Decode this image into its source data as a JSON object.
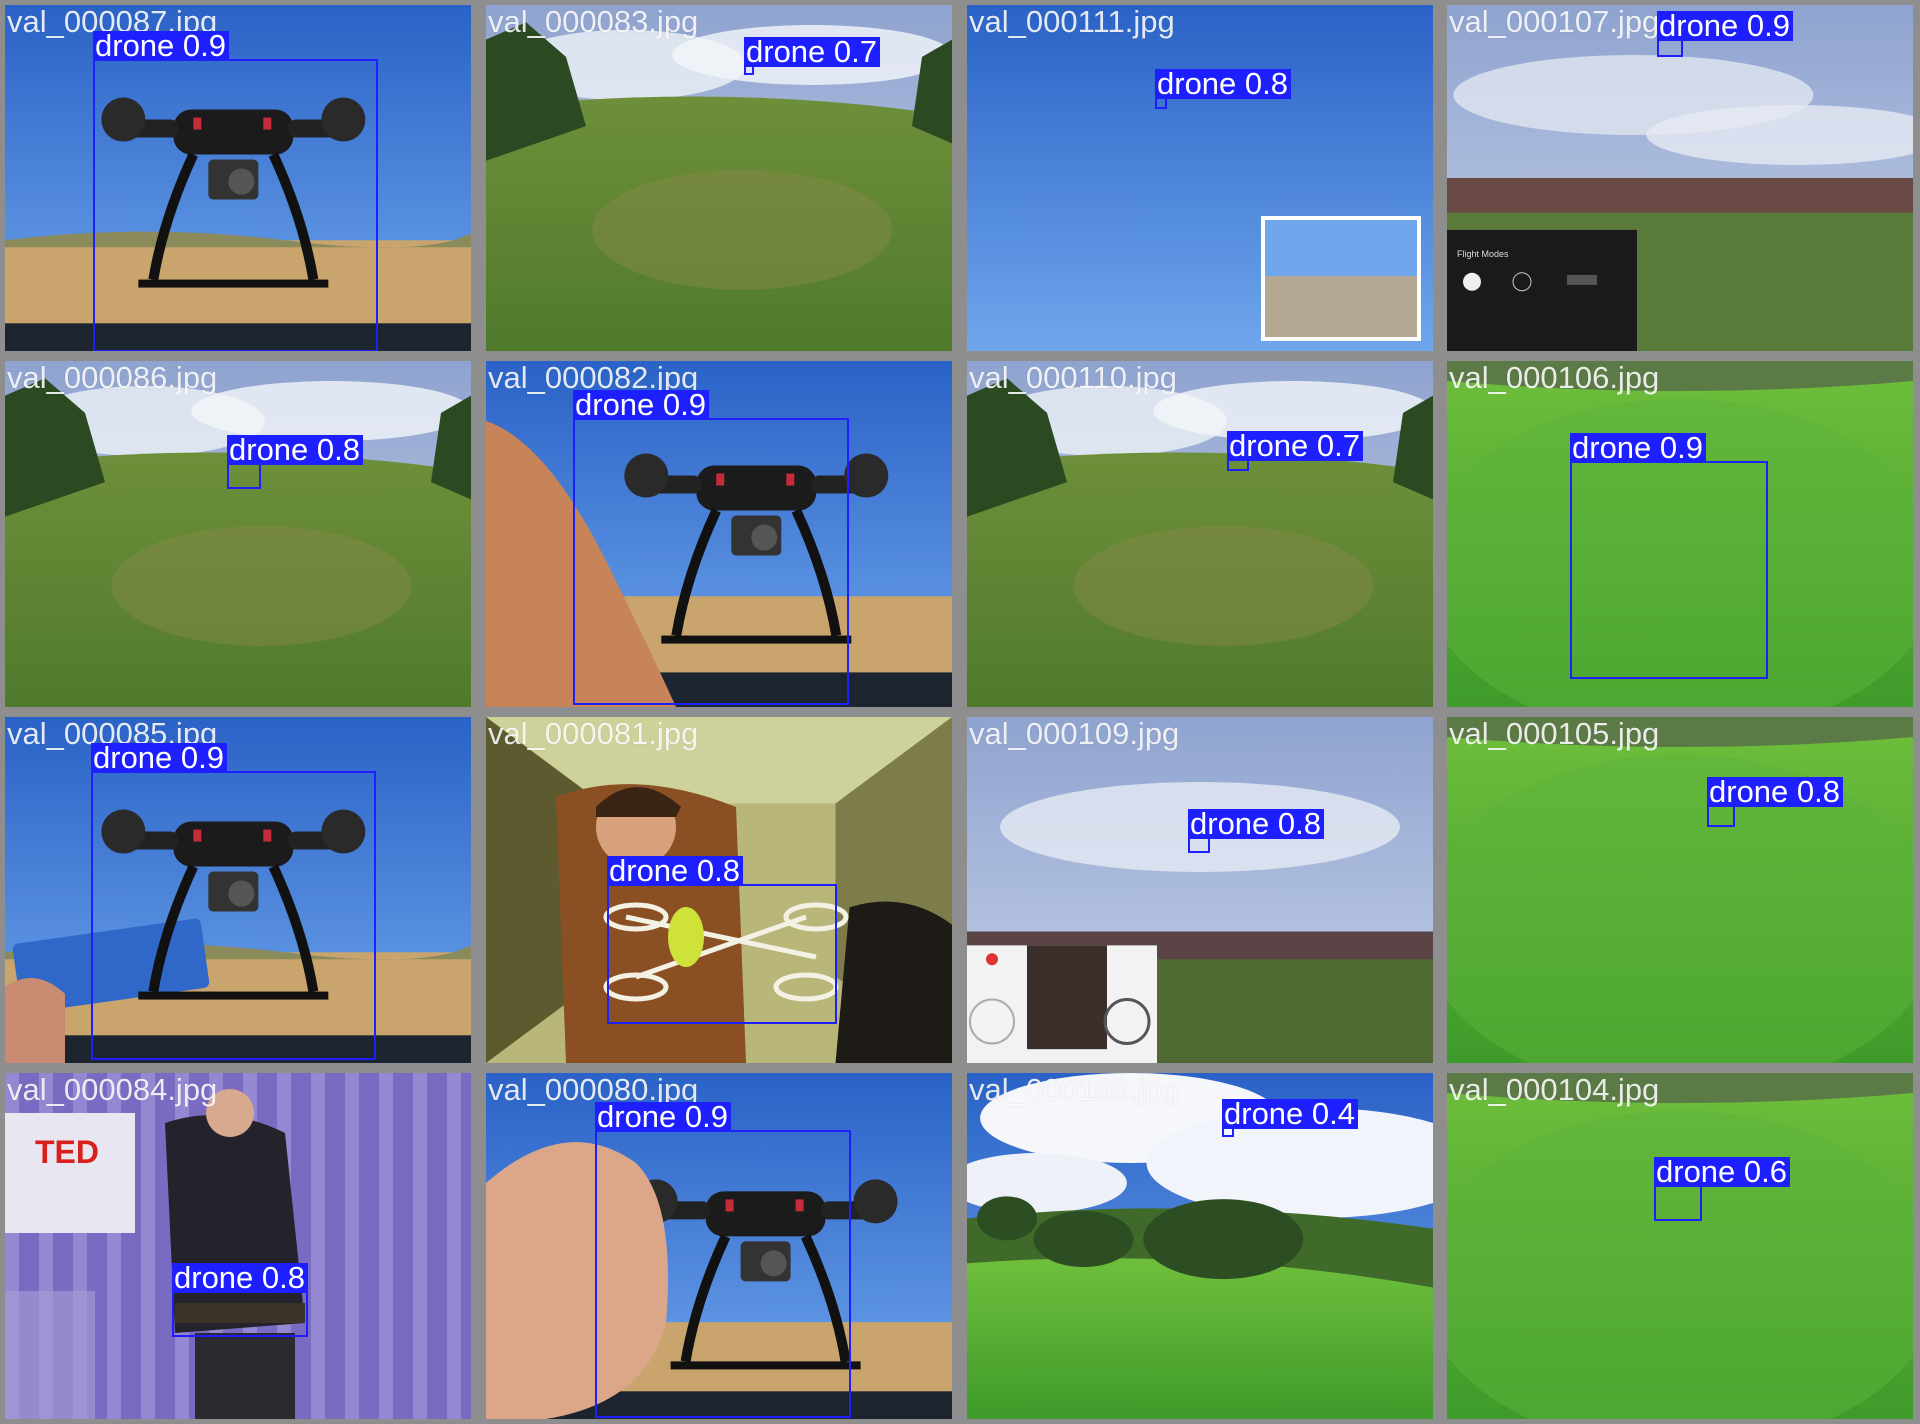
{
  "colors": {
    "background": "#8e8e8e",
    "box": "#1d1fff",
    "label_text": "#ffffff",
    "filename_text": "#ffffff"
  },
  "tiles": [
    {
      "filename": "val_000087.jpg",
      "scene": "drone-desert",
      "detections": [
        {
          "label": "drone 0.9"
        }
      ]
    },
    {
      "filename": "val_000083.jpg",
      "scene": "field-sky",
      "detections": [
        {
          "label": "drone 0.7"
        }
      ]
    },
    {
      "filename": "val_000111.jpg",
      "scene": "sky-inset",
      "detections": [
        {
          "label": "drone 0.8"
        }
      ]
    },
    {
      "filename": "val_000107.jpg",
      "scene": "cloud-app",
      "detections": [
        {
          "label": "drone 0.9"
        }
      ]
    },
    {
      "filename": "val_000086.jpg",
      "scene": "field-sky",
      "detections": [
        {
          "label": "drone 0.8"
        }
      ]
    },
    {
      "filename": "val_000082.jpg",
      "scene": "drone-arm",
      "detections": [
        {
          "label": "drone 0.9"
        }
      ]
    },
    {
      "filename": "val_000110.jpg",
      "scene": "field-sky",
      "detections": [
        {
          "label": "drone 0.7"
        }
      ]
    },
    {
      "filename": "val_000106.jpg",
      "scene": "green-grass",
      "detections": [
        {
          "label": "drone 0.9"
        }
      ]
    },
    {
      "filename": "val_000085.jpg",
      "scene": "drone-battery",
      "detections": [
        {
          "label": "drone 0.9"
        }
      ]
    },
    {
      "filename": "val_000081.jpg",
      "scene": "indoor",
      "detections": [
        {
          "label": "drone 0.8"
        }
      ]
    },
    {
      "filename": "val_000109.jpg",
      "scene": "cloud-controls",
      "detections": [
        {
          "label": "drone 0.8"
        }
      ]
    },
    {
      "filename": "val_000105.jpg",
      "scene": "green-grass",
      "detections": [
        {
          "label": "drone 0.8"
        }
      ]
    },
    {
      "filename": "val_000084.jpg",
      "scene": "stage",
      "detections": [
        {
          "label": "drone 0.8"
        }
      ]
    },
    {
      "filename": "val_000080.jpg",
      "scene": "drone-hand",
      "detections": [
        {
          "label": "drone 0.9"
        }
      ]
    },
    {
      "filename": "val_000108.jpg",
      "scene": "park-clouds",
      "detections": [
        {
          "label": "drone 0.4"
        }
      ]
    },
    {
      "filename": "val_000104.jpg",
      "scene": "green-grass",
      "detections": [
        {
          "label": "drone 0.6"
        }
      ]
    }
  ],
  "scene_text": {
    "ted_logo": "TED",
    "app_title": "Flight Modes"
  }
}
